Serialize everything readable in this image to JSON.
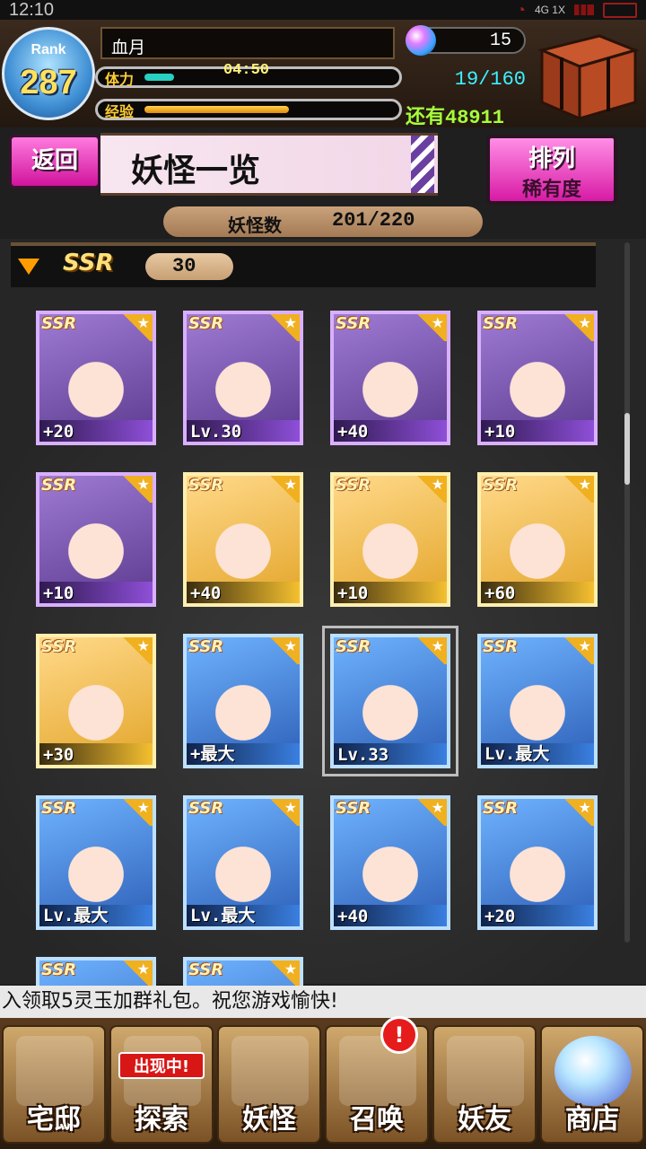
{
  "status_bar": {
    "time": "12:10",
    "network": "4G 1X"
  },
  "header": {
    "rank_label": "Rank",
    "rank_value": "287",
    "player_name": "血月",
    "stamina_label": "体力",
    "stamina_timer": "04:50",
    "stamina_count": "19/160",
    "stamina_fraction": 0.12,
    "exp_label": "经验",
    "exp_fraction": 0.58,
    "exp_remaining": "还有48911",
    "gem_count": "15"
  },
  "toolbar": {
    "back_label": "返回",
    "title": "妖怪一览",
    "sort_label": "排列",
    "sort_value": "稀有度"
  },
  "count": {
    "label": "妖怪数",
    "value": "201/220"
  },
  "section": {
    "rarity": "SSR",
    "count": "30"
  },
  "cards": [
    {
      "rarity": "SSR",
      "level": "+20",
      "frame": "purple"
    },
    {
      "rarity": "SSR",
      "level": "Lv.30",
      "frame": "purple"
    },
    {
      "rarity": "SSR",
      "level": "+40",
      "frame": "purple"
    },
    {
      "rarity": "SSR",
      "level": "+10",
      "frame": "purple"
    },
    {
      "rarity": "SSR",
      "level": "+10",
      "frame": "purple"
    },
    {
      "rarity": "SSR",
      "level": "+40",
      "frame": "gold"
    },
    {
      "rarity": "SSR",
      "level": "+10",
      "frame": "gold"
    },
    {
      "rarity": "SSR",
      "level": "+60",
      "frame": "gold"
    },
    {
      "rarity": "SSR",
      "level": "+30",
      "frame": "gold"
    },
    {
      "rarity": "SSR",
      "level": "+最大",
      "frame": "blue"
    },
    {
      "rarity": "SSR",
      "level": "Lv.33",
      "frame": "blue"
    },
    {
      "rarity": "SSR",
      "level": "Lv.最大",
      "frame": "blue"
    },
    {
      "rarity": "SSR",
      "level": "Lv.最大",
      "frame": "blue"
    },
    {
      "rarity": "SSR",
      "level": "Lv.最大",
      "frame": "blue"
    },
    {
      "rarity": "SSR",
      "level": "+40",
      "frame": "blue"
    },
    {
      "rarity": "SSR",
      "level": "+20",
      "frame": "blue"
    },
    {
      "rarity": "SSR",
      "level": "",
      "frame": "blue"
    },
    {
      "rarity": "SSR",
      "level": "",
      "frame": "blue"
    }
  ],
  "ticker": "入领取5灵玉加群礼包。祝您游戏愉快!",
  "nav": {
    "home": "宅邸",
    "explore": "探索",
    "explore_badge": "出现中!",
    "yokai": "妖怪",
    "summon": "召唤",
    "summon_alert": "!",
    "friends": "妖友",
    "shop": "商店"
  },
  "icons": [
    "rank-badge-icon",
    "gem-icon",
    "present-box-icon",
    "section-collapse-arrow-icon",
    "mansion-icon",
    "magnifier-icon",
    "scroll-icon",
    "pentagram-icon",
    "friend-icon",
    "crystal-ball-icon"
  ]
}
